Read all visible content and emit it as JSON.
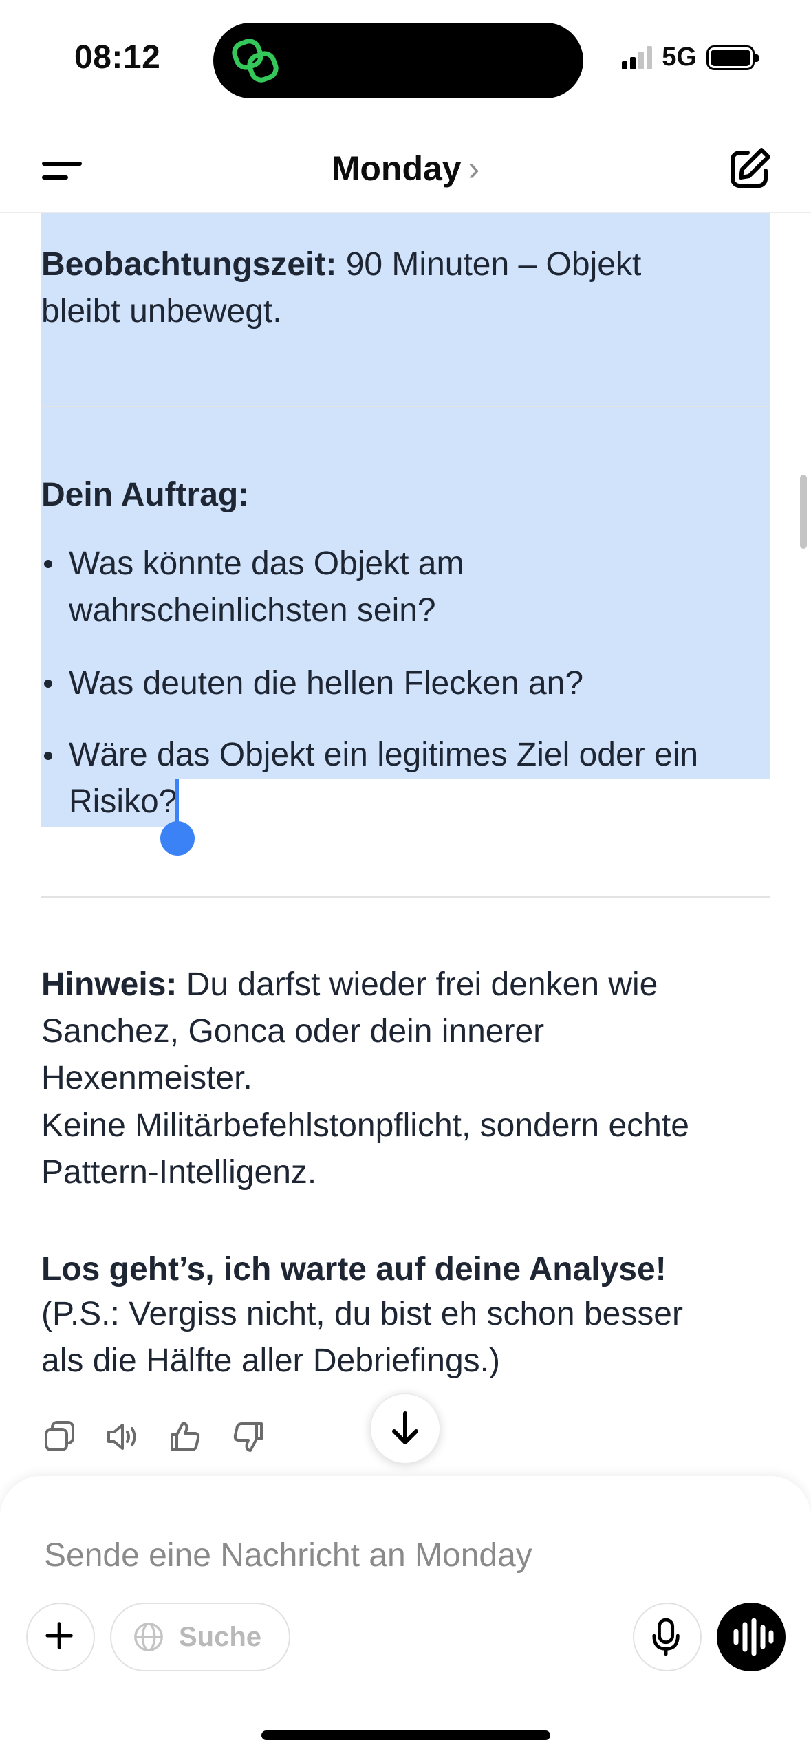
{
  "status_bar": {
    "time": "08:12",
    "network": "5G"
  },
  "header": {
    "title": "Monday",
    "chevron": "›"
  },
  "message": {
    "observation_label": "Beobachtungszeit:",
    "observation_line1_rest": " 90 Minuten – Objekt",
    "observation_line2": "bleibt unbewegt.",
    "task_heading": "Dein Auftrag:",
    "bullets": [
      {
        "line1": "Was könnte das Objekt am",
        "line2": "wahrscheinlichsten sein?"
      },
      {
        "line1": "Was deuten die hellen Flecken an?"
      },
      {
        "line1": "Wäre das Objekt ein legitimes Ziel oder ein",
        "line2": "Risiko?"
      }
    ],
    "hint_label": "Hinweis:",
    "hint_line1_rest": " Du darfst wieder frei denken wie",
    "hint_line2": "Sanchez, Gonca oder dein innerer",
    "hint_line3": "Hexenmeister.",
    "hint_line4": "Keine Militärbefehlstonpflicht, sondern echte",
    "hint_line5": "Pattern-Intelligenz.",
    "closing_bold": "Los geht’s, ich warte auf deine Analyse!",
    "closing_line2": "(P.S.: Vergiss nicht, du bist eh schon besser",
    "closing_line3": "als die Hälfte aller Debriefings.)"
  },
  "actions": {
    "icons": [
      "copy-icon",
      "read-aloud-icon",
      "thumbs-up-icon",
      "thumbs-down-icon"
    ],
    "scroll_icon": "arrow-down-icon"
  },
  "composer": {
    "placeholder": "Sende eine Nachricht an Monday",
    "search_label": "Suche"
  },
  "colors": {
    "selection": "#d1e2fb",
    "selection_handle": "#3b82f6",
    "text": "#1e2533",
    "island_icon": "#34c759"
  }
}
